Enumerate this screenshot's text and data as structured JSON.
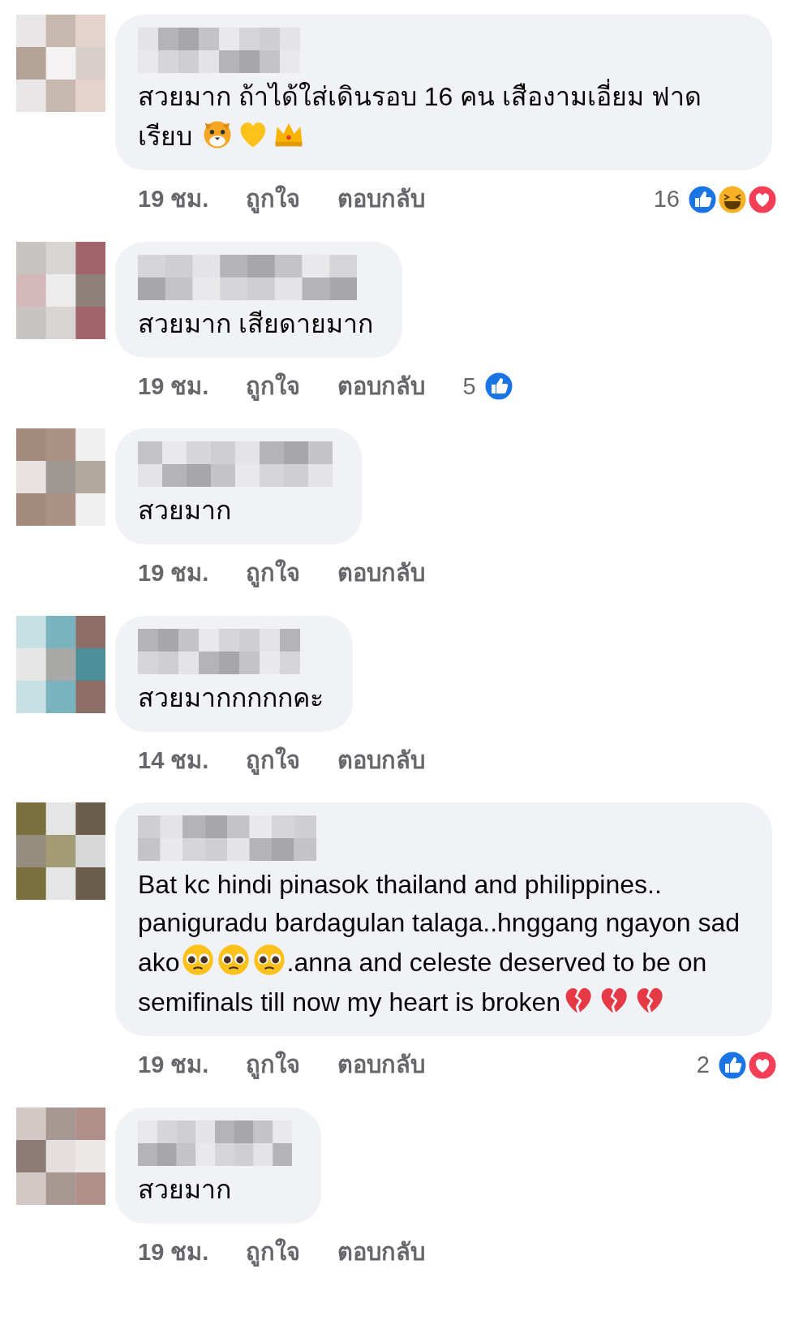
{
  "comments": [
    {
      "body": [
        {
          "kind": "text",
          "text": "สวยมาก ถ้าได้ใส่เดินรอบ 16 คน เสืองามเอี่ยม ฟาดเรียบ "
        },
        {
          "kind": "tiger"
        },
        {
          "kind": "heart"
        },
        {
          "kind": "crown"
        }
      ],
      "time": "19 ชม.",
      "like": "ถูกใจ",
      "reply": "ตอบกลับ",
      "reactions": {
        "count": "16",
        "types": [
          {
            "kind": "like"
          },
          {
            "kind": "haha"
          },
          {
            "kind": "love"
          }
        ]
      }
    },
    {
      "body": [
        {
          "kind": "text",
          "text": "สวยมาก เสียดายมาก"
        }
      ],
      "time": "19 ชม.",
      "like": "ถูกใจ",
      "reply": "ตอบกลับ",
      "reactions": {
        "count": "5",
        "types": [
          {
            "kind": "like"
          }
        ]
      }
    },
    {
      "body": [
        {
          "kind": "text",
          "text": "สวยมาก"
        }
      ],
      "time": "19 ชม.",
      "like": "ถูกใจ",
      "reply": "ตอบกลับ"
    },
    {
      "body": [
        {
          "kind": "text",
          "text": "สวยมากกกกกคะ"
        }
      ],
      "time": "14 ชม.",
      "like": "ถูกใจ",
      "reply": "ตอบกลับ"
    },
    {
      "body": [
        {
          "kind": "text",
          "text": "Bat kc hindi pinasok thailand and philippines.. paniguradu bardagulan talaga..hnggang ngayon sad ako"
        },
        {
          "kind": "pleading"
        },
        {
          "kind": "pleading"
        },
        {
          "kind": "pleading"
        },
        {
          "kind": "text",
          "text": ".anna and celeste deserved to be on semifinals till now my heart is broken"
        },
        {
          "kind": "brokenheart"
        },
        {
          "kind": "brokenheart"
        },
        {
          "kind": "brokenheart"
        }
      ],
      "time": "19 ชม.",
      "like": "ถูกใจ",
      "reply": "ตอบกลับ",
      "reactions": {
        "count": "2",
        "types": [
          {
            "kind": "like"
          },
          {
            "kind": "love"
          }
        ]
      }
    },
    {
      "body": [
        {
          "kind": "text",
          "text": "สวยมาก"
        }
      ],
      "time": "19 ชม.",
      "like": "ถูกใจ",
      "reply": "ตอบกลับ"
    }
  ]
}
